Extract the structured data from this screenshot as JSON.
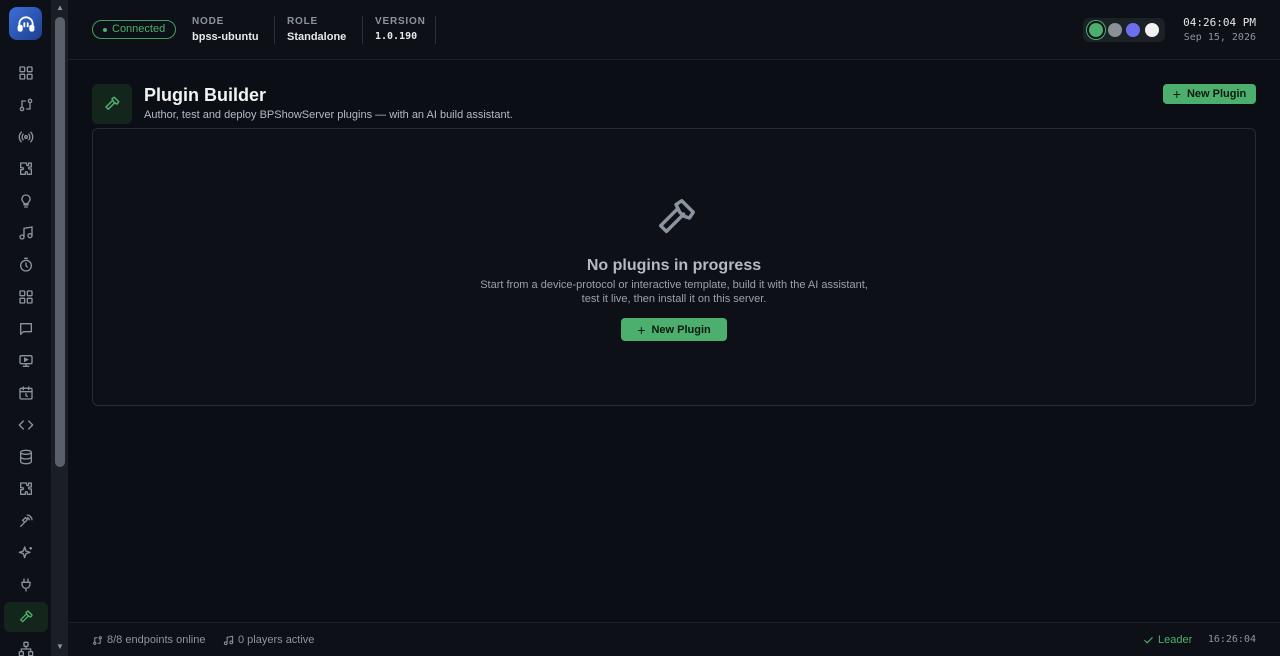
{
  "header": {
    "status": "Connected",
    "node_label": "NODE",
    "node_value": "bpss-ubuntu",
    "role_label": "ROLE",
    "role_value": "Standalone",
    "version_label": "VERSION",
    "version_value": "1.0.190",
    "theme_swatches": [
      "#4caf6e",
      "#8b8f96",
      "#6c6ef0",
      "#f2f2f2"
    ],
    "time": "04:26:04 PM",
    "date": "Sep 15, 2026"
  },
  "sidebar": {
    "items": [
      {
        "icon": "dashboard-icon"
      },
      {
        "icon": "routing-icon"
      },
      {
        "icon": "broadcast-icon"
      },
      {
        "icon": "puzzle-icon"
      },
      {
        "icon": "lightbulb-icon"
      },
      {
        "icon": "music-icon"
      },
      {
        "icon": "timer-icon"
      },
      {
        "icon": "apps-grid-icon"
      },
      {
        "icon": "chat-icon"
      },
      {
        "icon": "display-icon"
      },
      {
        "icon": "schedule-icon"
      },
      {
        "icon": "code-icon"
      },
      {
        "icon": "database-icon"
      },
      {
        "icon": "extension-icon"
      },
      {
        "icon": "signal-icon"
      },
      {
        "icon": "sparkles-icon"
      },
      {
        "icon": "plug-icon"
      },
      {
        "icon": "hammer-icon",
        "active": true
      },
      {
        "icon": "network-icon"
      }
    ]
  },
  "page": {
    "title": "Plugin Builder",
    "subtitle": "Author, test and deploy BPShowServer plugins — with an AI build assistant.",
    "new_plugin_label": "New Plugin"
  },
  "empty_state": {
    "title": "No plugins in progress",
    "line1": "Start from a device-protocol or interactive template, build it with the AI assistant,",
    "line2": "test it live, then install it on this server.",
    "button_label": "New Plugin"
  },
  "footer": {
    "endpoints": "8/8 endpoints online",
    "players": "0 players active",
    "leader": "Leader",
    "time": "16:26:04"
  }
}
